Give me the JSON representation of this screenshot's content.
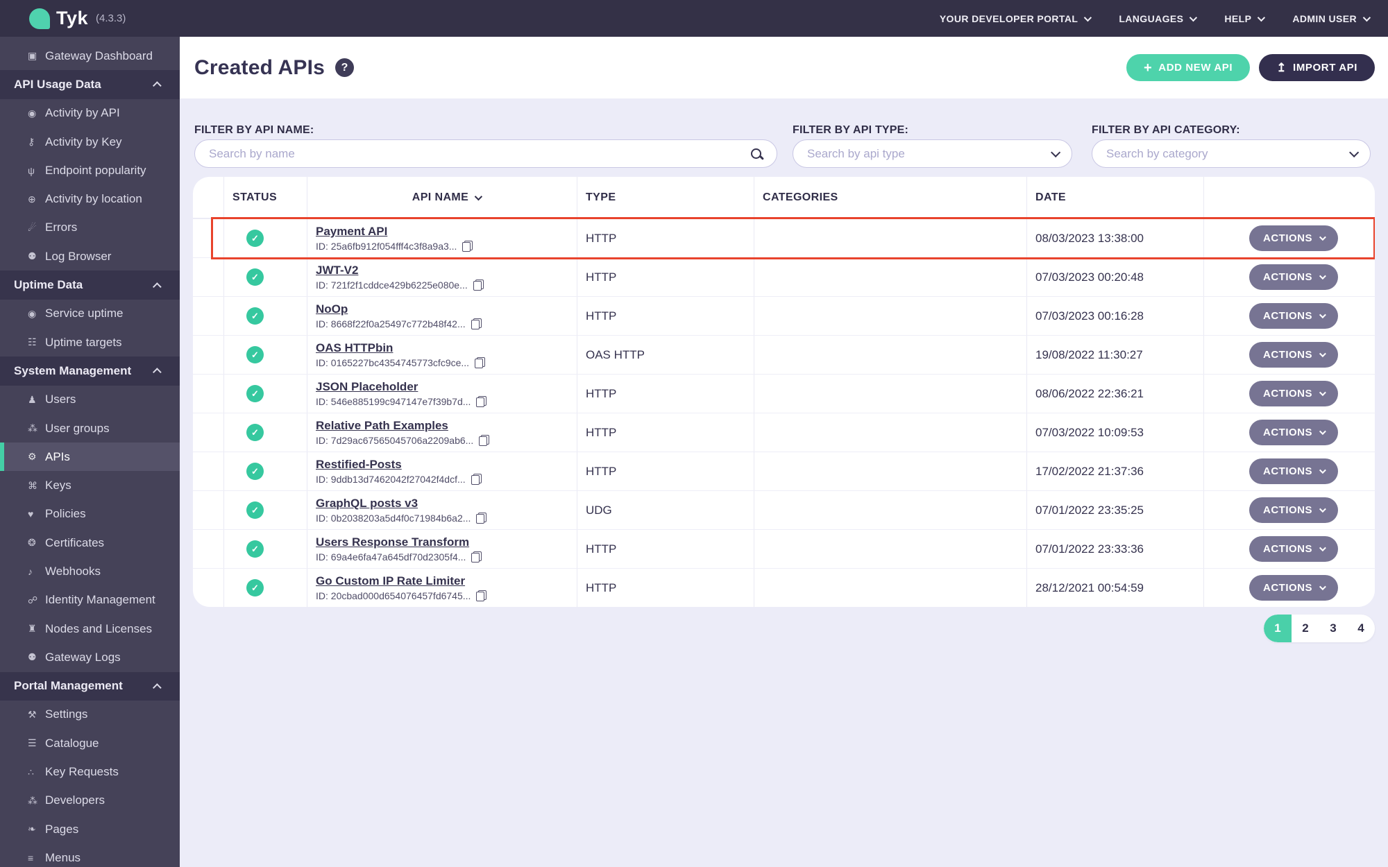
{
  "topbar": {
    "logo_text": "Tyk",
    "version": "(4.3.3)",
    "menus": [
      {
        "label": "YOUR DEVELOPER PORTAL"
      },
      {
        "label": "LANGUAGES"
      },
      {
        "label": "HELP"
      },
      {
        "label": "ADMIN USER"
      }
    ]
  },
  "sidebar": {
    "entries": [
      {
        "label": "Gateway Dashboard",
        "icon": "monitor-icon"
      },
      {
        "label": "API Usage Data",
        "is_header": true
      },
      {
        "label": "Activity by API",
        "icon": "activity-icon"
      },
      {
        "label": "Activity by Key",
        "icon": "key-icon"
      },
      {
        "label": "Endpoint popularity",
        "icon": "branch-icon"
      },
      {
        "label": "Activity by location",
        "icon": "globe-icon"
      },
      {
        "label": "Errors",
        "icon": "error-icon"
      },
      {
        "label": "Log Browser",
        "icon": "bug-icon"
      },
      {
        "label": "Uptime Data",
        "is_header": true
      },
      {
        "label": "Service uptime",
        "icon": "uptime-icon"
      },
      {
        "label": "Uptime targets",
        "icon": "targets-icon"
      },
      {
        "label": "System Management",
        "is_header": true
      },
      {
        "label": "Users",
        "icon": "user-icon"
      },
      {
        "label": "User groups",
        "icon": "user-group-icon"
      },
      {
        "label": "APIs",
        "icon": "gear-icon",
        "active": true
      },
      {
        "label": "Keys",
        "icon": "keys-icon"
      },
      {
        "label": "Policies",
        "icon": "policy-icon"
      },
      {
        "label": "Certificates",
        "icon": "certificate-icon"
      },
      {
        "label": "Webhooks",
        "icon": "bell-icon"
      },
      {
        "label": "Identity Management",
        "icon": "identity-icon"
      },
      {
        "label": "Nodes and Licenses",
        "icon": "bank-icon"
      },
      {
        "label": "Gateway Logs",
        "icon": "gateway-log-icon"
      },
      {
        "label": "Portal Management",
        "is_header": true
      },
      {
        "label": "Settings",
        "icon": "wrench-icon"
      },
      {
        "label": "Catalogue",
        "icon": "catalogue-icon"
      },
      {
        "label": "Key Requests",
        "icon": "key-request-icon"
      },
      {
        "label": "Developers",
        "icon": "developers-icon"
      },
      {
        "label": "Pages",
        "icon": "pages-icon"
      },
      {
        "label": "Menus",
        "icon": "menu-icon"
      }
    ]
  },
  "page": {
    "title": "Created APIs",
    "help_label": "?",
    "add_button_label": "ADD NEW API",
    "import_button_label": "IMPORT API"
  },
  "filters": [
    {
      "label": "FILTER BY API NAME:",
      "placeholder": "Search by name"
    },
    {
      "label": "FILTER BY API TYPE:",
      "placeholder": "Search by api type"
    },
    {
      "label": "FILTER BY API CATEGORY:",
      "placeholder": "Search by category"
    }
  ],
  "table": {
    "columns": [
      "STATUS",
      "API NAME",
      "TYPE",
      "CATEGORIES",
      "DATE"
    ],
    "actions_label": "ACTIONS",
    "rows": [
      {
        "status": "active",
        "name": "Payment API",
        "id": "ID: 25a6fb912f054fff4c3f8a9a3...",
        "type": "HTTP",
        "categories": "",
        "date": "08/03/2023 13:38:00",
        "highlighted": true
      },
      {
        "status": "active",
        "name": "JWT-V2",
        "id": "ID: 721f2f1cddce429b6225e080e...",
        "type": "HTTP",
        "categories": "",
        "date": "07/03/2023 00:20:48"
      },
      {
        "status": "active",
        "name": "NoOp",
        "id": "ID: 8668f22f0a25497c772b48f42...",
        "type": "HTTP",
        "categories": "",
        "date": "07/03/2023 00:16:28"
      },
      {
        "status": "active",
        "name": "OAS HTTPbin",
        "id": "ID: 0165227bc4354745773cfc9ce...",
        "type": "OAS HTTP",
        "categories": "",
        "date": "19/08/2022 11:30:27"
      },
      {
        "status": "active",
        "name": "JSON Placeholder",
        "id": "ID: 546e885199c947147e7f39b7d...",
        "type": "HTTP",
        "categories": "",
        "date": "08/06/2022 22:36:21"
      },
      {
        "status": "active",
        "name": "Relative Path Examples",
        "id": "ID: 7d29ac67565045706a2209ab6...",
        "type": "HTTP",
        "categories": "",
        "date": "07/03/2022 10:09:53"
      },
      {
        "status": "active",
        "name": "Restified-Posts",
        "id": "ID: 9ddb13d7462042f27042f4dcf...",
        "type": "HTTP",
        "categories": "",
        "date": "17/02/2022 21:37:36"
      },
      {
        "status": "active",
        "name": "GraphQL posts v3",
        "id": "ID: 0b2038203a5d4f0c71984b6a2...",
        "type": "UDG",
        "categories": "",
        "date": "07/01/2022 23:35:25"
      },
      {
        "status": "active",
        "name": "Users Response Transform",
        "id": "ID: 69a4e6fa47a645df70d2305f4...",
        "type": "HTTP",
        "categories": "",
        "date": "07/01/2022 23:33:36"
      },
      {
        "status": "active",
        "name": "Go Custom IP Rate Limiter",
        "id": "ID: 20cbad000d654076457fd6745...",
        "type": "HTTP",
        "categories": "",
        "date": "28/12/2021 00:54:59"
      }
    ]
  },
  "pagination": {
    "pages": [
      {
        "label": "1",
        "active": true
      },
      {
        "label": "2"
      },
      {
        "label": "3"
      },
      {
        "label": "4"
      }
    ]
  },
  "colors": {
    "accent_teal": "#4ED3AB",
    "topbar_navy": "#343147",
    "sidebar_purple": "#454258",
    "section_header_purple": "#37344C",
    "status_green": "#36C89F",
    "actions_gray": "#777493",
    "highlight_red": "#E8432C",
    "main_background": "#ECECF8",
    "dark_text": "#35324E"
  }
}
